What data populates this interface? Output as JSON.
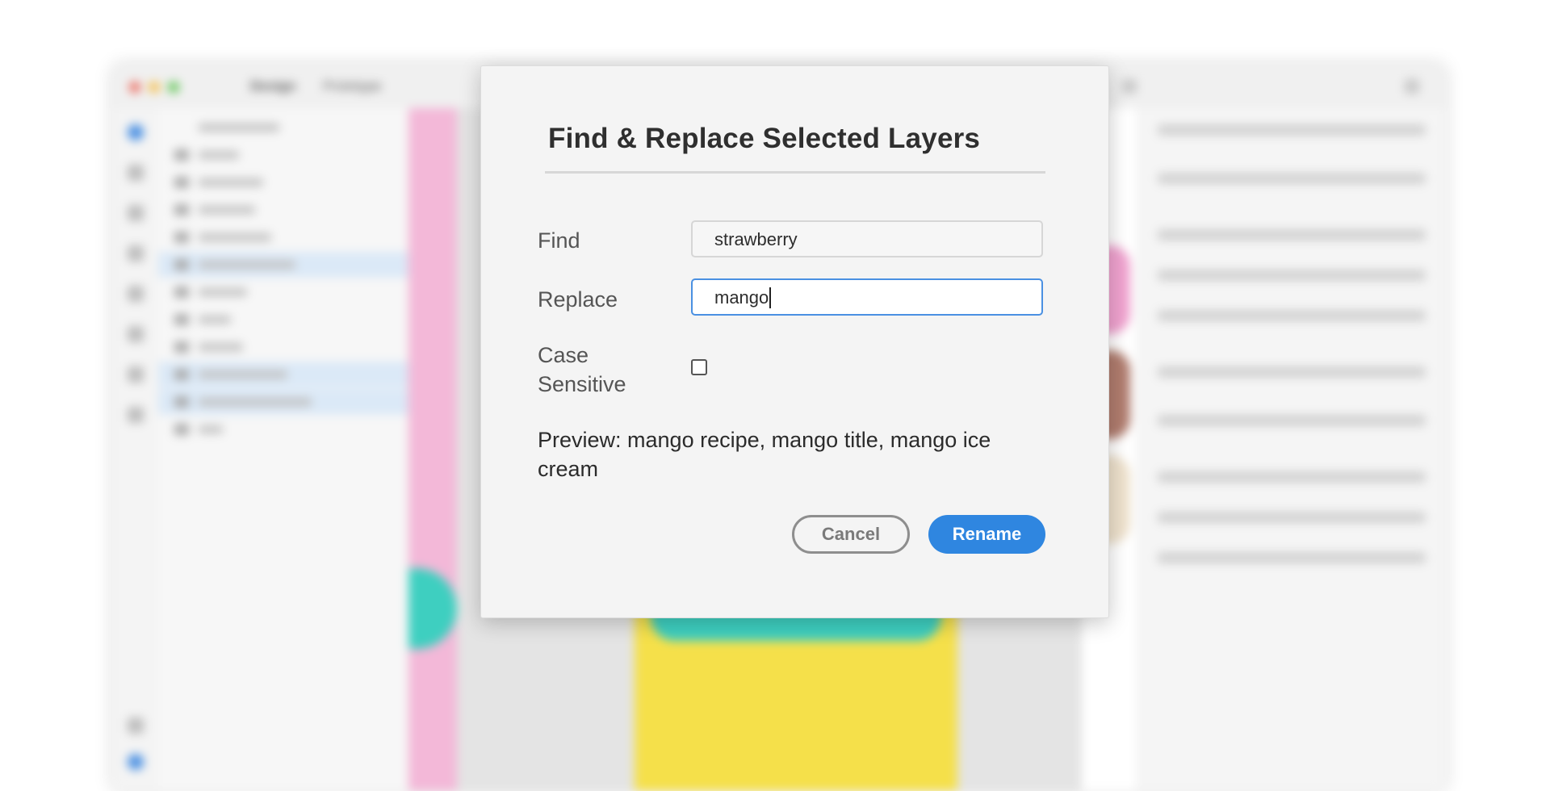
{
  "app": {
    "tabs": [
      "Design",
      "Prototype"
    ]
  },
  "dialog": {
    "title": "Find & Replace Selected Layers",
    "find_label": "Find",
    "find_value": "strawberry",
    "replace_label": "Replace",
    "replace_value": "mango",
    "case_label": "Case Sensitive",
    "case_checked": false,
    "preview_text": "Preview: mango recipe, mango title, mango ice cream",
    "cancel_label": "Cancel",
    "rename_label": "Rename"
  },
  "colors": {
    "accent": "#2f86e0",
    "focus_border": "#4a90e2",
    "dialog_bg": "#f4f4f4"
  }
}
